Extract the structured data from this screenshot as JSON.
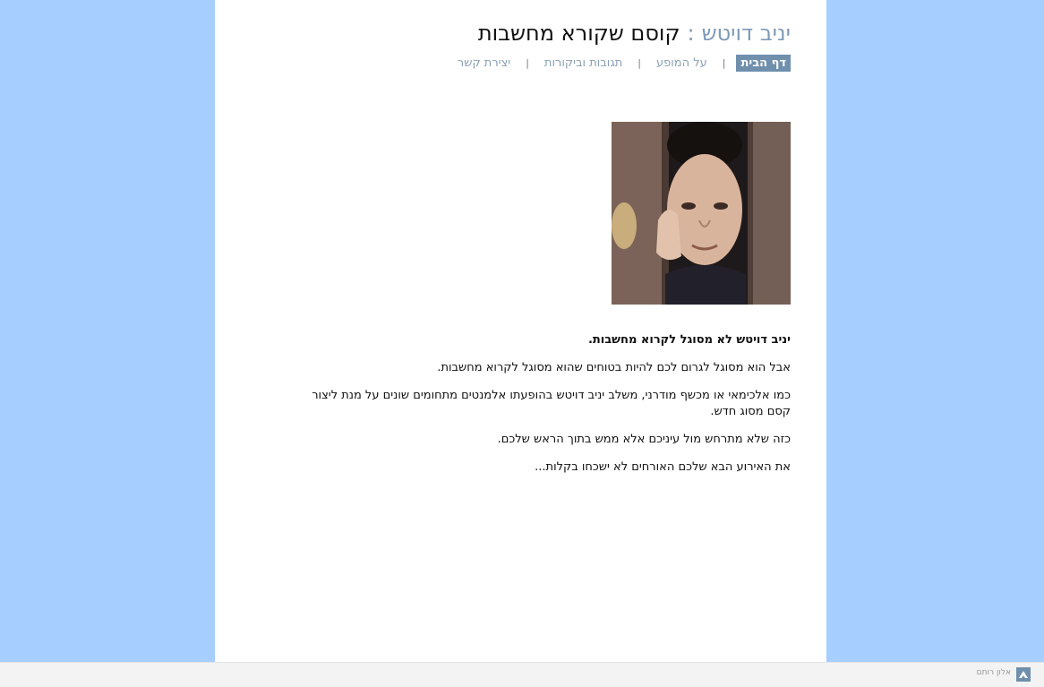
{
  "header": {
    "name": "יניב דויטש",
    "separator": ":",
    "tagline": "קוסם שקורא מחשבות"
  },
  "nav": {
    "items": [
      {
        "label": "דף הבית",
        "active": true
      },
      {
        "label": "על המופע"
      },
      {
        "label": "תגובות וביקורות"
      },
      {
        "label": "יצירת קשר"
      }
    ],
    "separator": "|"
  },
  "content": {
    "lead": "יניב דויטש לא מסוגל לקרוא מחשבות.",
    "paragraphs": [
      "אבל הוא מסוגל לגרום לכם להיות בטוחים שהוא מסוגל לקרוא מחשבות.",
      "כמו אלכימאי או מכשף מודרני, משלב יניב דויטש בהופעתו אלמנטים מתחומים שונים על מנת ליצור קסם מסוג חדש.",
      "כזה שלא מתרחש מול עיניכם אלא ממש בתוך הראש שלכם.",
      "את האירוע הבא שלכם האורחים לא ישכחו בקלות..."
    ]
  },
  "footer": {
    "credit": "אלון רותם"
  },
  "colors": {
    "background": "#a6cfff",
    "accent": "#6f8fad",
    "title_name": "#7f9ab8"
  }
}
